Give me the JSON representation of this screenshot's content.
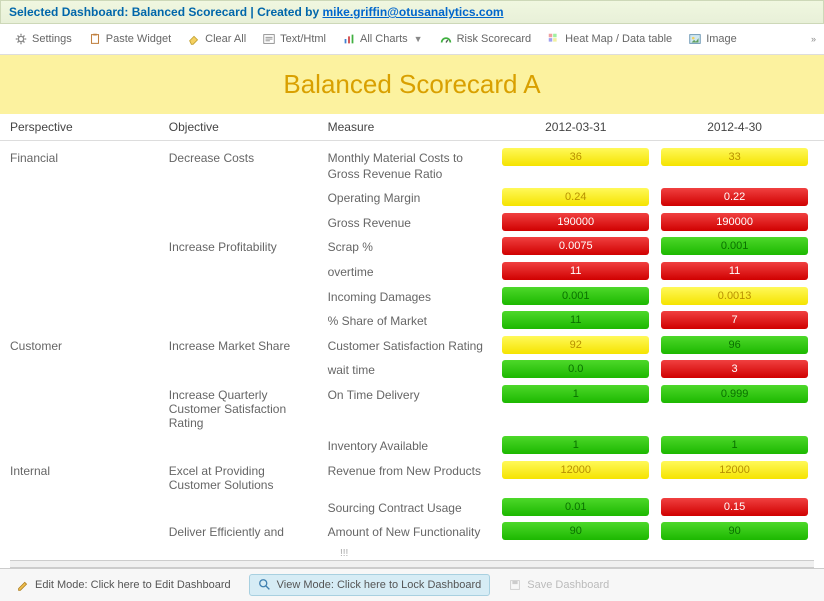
{
  "header": {
    "prefix": "Selected Dashboard: ",
    "name": "Balanced Scorecard",
    "sep": " | Created by ",
    "author": "mike.griffin@otusanalytics.com"
  },
  "toolbar": {
    "settings": "Settings",
    "paste": "Paste Widget",
    "clear": "Clear All",
    "text": "Text/Html",
    "charts": "All Charts",
    "risk": "Risk Scorecard",
    "heatmap": "Heat Map / Data table",
    "image": "Image"
  },
  "title": "Balanced Scorecard A",
  "columns": {
    "perspective": "Perspective",
    "objective": "Objective",
    "measure": "Measure",
    "d1": "2012-03-31",
    "d2": "2012-4-30"
  },
  "rows": [
    {
      "p": "Financial",
      "o": "Decrease Costs",
      "m": "Monthly Material Costs to Gross Revenue Ratio",
      "v1": {
        "val": "36",
        "c": "yellow"
      },
      "v2": {
        "val": "33",
        "c": "yellow"
      }
    },
    {
      "p": "",
      "o": "",
      "m": "Operating Margin",
      "v1": {
        "val": "0.24",
        "c": "yellow"
      },
      "v2": {
        "val": "0.22",
        "c": "red"
      }
    },
    {
      "p": "",
      "o": "",
      "m": "Gross Revenue",
      "v1": {
        "val": "190000",
        "c": "red"
      },
      "v2": {
        "val": "190000",
        "c": "red"
      }
    },
    {
      "p": "",
      "o": "Increase Profitability",
      "m": "Scrap %",
      "v1": {
        "val": "0.0075",
        "c": "red"
      },
      "v2": {
        "val": "0.001",
        "c": "green"
      }
    },
    {
      "p": "",
      "o": "",
      "m": "overtime",
      "v1": {
        "val": "11",
        "c": "red"
      },
      "v2": {
        "val": "11",
        "c": "red"
      }
    },
    {
      "p": "",
      "o": "",
      "m": "Incoming Damages",
      "v1": {
        "val": "0.001",
        "c": "green"
      },
      "v2": {
        "val": "0.0013",
        "c": "yellow"
      }
    },
    {
      "p": "",
      "o": "",
      "m": "% Share of Market",
      "v1": {
        "val": "11",
        "c": "green"
      },
      "v2": {
        "val": "7",
        "c": "red"
      }
    },
    {
      "p": "Customer",
      "o": "Increase Market Share",
      "m": "Customer Satisfaction Rating",
      "v1": {
        "val": "92",
        "c": "yellow"
      },
      "v2": {
        "val": "96",
        "c": "green"
      }
    },
    {
      "p": "",
      "o": "",
      "m": "wait time",
      "v1": {
        "val": "0.0",
        "c": "green"
      },
      "v2": {
        "val": "3",
        "c": "red"
      }
    },
    {
      "p": "",
      "o": "Increase Quarterly Customer Satisfaction Rating",
      "m": "On Time Delivery",
      "v1": {
        "val": "1",
        "c": "green"
      },
      "v2": {
        "val": "0.999",
        "c": "green"
      }
    },
    {
      "p": "",
      "o": "",
      "m": "Inventory Available",
      "v1": {
        "val": "1",
        "c": "green"
      },
      "v2": {
        "val": "1",
        "c": "green"
      }
    },
    {
      "p": "Internal",
      "o": "Excel at Providing Customer Solutions",
      "m": "Revenue from New Products",
      "v1": {
        "val": "12000",
        "c": "yellow"
      },
      "v2": {
        "val": "12000",
        "c": "yellow"
      }
    },
    {
      "p": "",
      "o": "",
      "m": "Sourcing Contract Usage",
      "v1": {
        "val": "0.01",
        "c": "green"
      },
      "v2": {
        "val": "0.15",
        "c": "red"
      }
    },
    {
      "p": "",
      "o": "Deliver Efficiently and",
      "m": "Amount of New Functionality",
      "v1": {
        "val": "90",
        "c": "green"
      },
      "v2": {
        "val": "90",
        "c": "green"
      }
    }
  ],
  "footer": {
    "edit": "Edit Mode: Click here to Edit Dashboard",
    "view": "View Mode: Click here to Lock Dashboard",
    "save": "Save Dashboard"
  },
  "scroll_hint": "!!!"
}
